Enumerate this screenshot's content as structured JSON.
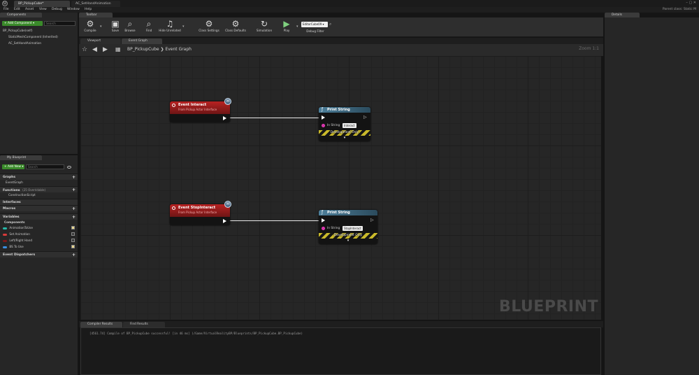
{
  "window": {
    "tabs": [
      "BP_PickupCube*",
      "AC_SetHandAnimation"
    ],
    "logo": "U",
    "controls": "–  ▢  ✕"
  },
  "menu": [
    "File",
    "Edit",
    "Asset",
    "View",
    "Debug",
    "Window",
    "Help"
  ],
  "parent_class": "Parent class: Static M",
  "components_panel": {
    "tab": "Components",
    "add_button": "+ Add Component ▾",
    "search_placeholder": "Search",
    "items": [
      "BP_PickupCube(self)",
      "StaticMeshComponent (Inherited)",
      "AC_SetHandAnimation"
    ]
  },
  "toolbar": {
    "tab": "Toolbar",
    "buttons": [
      {
        "label": "Compile",
        "icon": "⚙"
      },
      {
        "label": "Save",
        "icon": "▣"
      },
      {
        "label": "Browse",
        "icon": "⌕"
      },
      {
        "label": "Find",
        "icon": "⌕"
      },
      {
        "label": "Hide Unrelated",
        "icon": "♫"
      },
      {
        "label": "Class Settings",
        "icon": "⚙"
      },
      {
        "label": "Class Defaults",
        "icon": "⚙"
      },
      {
        "label": "Simulation",
        "icon": "↻"
      },
      {
        "label": "Play",
        "icon": "▶"
      }
    ],
    "debug_select": "EditorCube09 ▾",
    "debug_label": "Debug Filter"
  },
  "graph_tabs": {
    "viewport": "Viewport",
    "event_graph": "Event Graph"
  },
  "breadcrumb": {
    "blueprint": "BP_PickupCube",
    "separator": "❯",
    "graph": "Event Graph"
  },
  "zoom": "Zoom 1:1",
  "watermark": "BLUEPRINT",
  "nodes": {
    "event1": {
      "title": "Event Interact",
      "subtitle": "From Pickup Actor Interface"
    },
    "event2": {
      "title": "Event StopInteract",
      "subtitle": "From Pickup Actor Interface"
    },
    "print1": {
      "title": "Print String",
      "pin_label": "In String",
      "pin_value": "Interact",
      "dev": "Development Only"
    },
    "print2": {
      "title": "Print String",
      "pin_label": "In String",
      "pin_value": "StopInteract",
      "dev": "Development Only"
    }
  },
  "my_blueprint": {
    "tab": "My Blueprint",
    "add_new": "+ Add New ▾",
    "search_placeholder": "Search",
    "graphs": "Graphs",
    "event_graph": "EventGraph",
    "functions": "Functions",
    "functions_overridable": "(25 Overridable)",
    "construction_script": "ConstructionScript",
    "interfaces": "Interfaces",
    "macros": "Macros",
    "variables": "Variables",
    "components": "Components",
    "vars": [
      {
        "name": "AnimationToUse",
        "color": "#27b8a8",
        "visible": true
      },
      {
        "name": "Set Animation",
        "color": "#d83a3a",
        "visible": false
      },
      {
        "name": "Left/Right Hand",
        "color": "#7a1818",
        "visible": false
      },
      {
        "name": "BS To Use",
        "color": "#3a8fe0",
        "visible": true
      }
    ],
    "event_dispatchers": "Event Dispatchers"
  },
  "bottom": {
    "compiler_results": "Compiler Results",
    "find_results": "Find Results",
    "log": "[4561.74] Compile of BP_PickupCube successful! [in 46 ms] (/Game/VirtualRealityBP/Blueprints/BP_PickupCube.BP_PickupCube)"
  },
  "details": {
    "tab": "Details"
  },
  "colors": {
    "event_head": "#b82222",
    "function_head": "#4d7f9a",
    "string_pin": "#d431a8",
    "add_green": "#3a8a2a"
  }
}
